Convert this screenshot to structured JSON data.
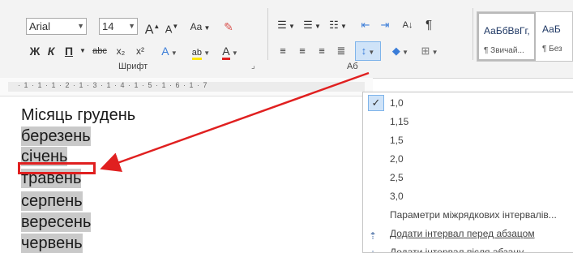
{
  "ribbon": {
    "font_name": "Arial",
    "font_size": "14",
    "font_group_label": "Шрифт",
    "para_group_label": "Аб",
    "font_buttons": {
      "grow": "A",
      "shrink": "A",
      "case": "Aa",
      "bold": "Ж",
      "italic": "К",
      "underline": "П",
      "strike": "abc",
      "subscript": "x₂",
      "superscript": "x²",
      "text_effects": "A",
      "highlight": "ab",
      "font_color": "A"
    },
    "para_buttons": {
      "pilcrow": "¶",
      "sort": "A↓"
    },
    "styles": [
      {
        "sample": "АаБбВвГг,",
        "name": "¶ Звичай..."
      },
      {
        "sample": "АаБ",
        "name": "¶ Без"
      }
    ]
  },
  "ruler": {
    "text": "· 1 · 1 · 1 · 2 · 1 · 3 · 1 · 4 · 1 · 5 · 1 · 6 · 1 · 7"
  },
  "document": {
    "lines": [
      {
        "text": "Місяць грудень"
      },
      {
        "text": "березень"
      },
      {
        "text": "січень"
      },
      {
        "text": "травень"
      },
      {
        "text": "серпень"
      },
      {
        "text": "вересень"
      },
      {
        "text": "червень"
      }
    ]
  },
  "spacing_menu": {
    "items": [
      {
        "label": "1,0",
        "checked": true
      },
      {
        "label": "1,15"
      },
      {
        "label": "1,5"
      },
      {
        "label": "2,0"
      },
      {
        "label": "2,5"
      },
      {
        "label": "3,0"
      }
    ],
    "options_label": "Параметри міжрядкових інтервалів...",
    "add_before_label": "Додати інтервал перед абзацом",
    "add_after_label": "Додати інтервал після абзацу"
  },
  "colors": {
    "annotation_red": "#e02020",
    "selection_gray": "#c9c9c9",
    "font_color_red": "#e02020",
    "highlight_yellow": "#ffe600",
    "check_blue": "#cfe3f8"
  }
}
